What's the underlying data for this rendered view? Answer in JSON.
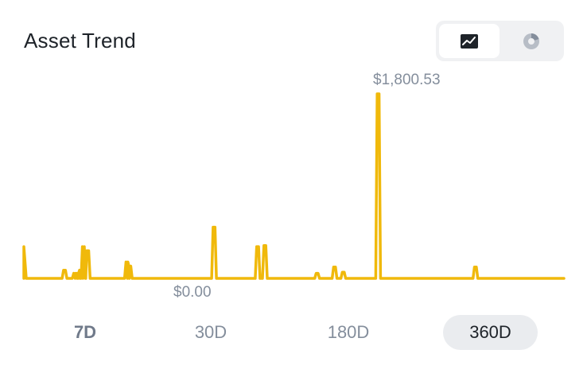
{
  "header": {
    "title": "Asset Trend"
  },
  "view_toggle": {
    "options": [
      {
        "icon": "line-chart-icon",
        "selected": true
      },
      {
        "icon": "pie-chart-icon",
        "selected": false
      }
    ]
  },
  "labels": {
    "max": "$1,800.53",
    "min": "$0.00"
  },
  "ranges": {
    "items": [
      "7D",
      "30D",
      "180D",
      "360D"
    ],
    "selected": "360D"
  },
  "colors": {
    "line": "#f0b90b",
    "title": "#1e2329",
    "muted": "#848e9c",
    "selected_bg": "#eaecef"
  },
  "chart_data": {
    "type": "line",
    "x_unit": "day index",
    "ylim": [
      0,
      1800.53
    ],
    "spikes": [
      {
        "day": 0,
        "value": 310
      },
      {
        "day": 28,
        "value": 80
      },
      {
        "day": 35,
        "value": 50
      },
      {
        "day": 37,
        "value": 50
      },
      {
        "day": 39,
        "value": 80
      },
      {
        "day": 41,
        "value": 310
      },
      {
        "day": 44,
        "value": 270
      },
      {
        "day": 71,
        "value": 160
      },
      {
        "day": 73,
        "value": 120
      },
      {
        "day": 131,
        "value": 500
      },
      {
        "day": 161,
        "value": 310
      },
      {
        "day": 166,
        "value": 320
      },
      {
        "day": 202,
        "value": 50
      },
      {
        "day": 214,
        "value": 110
      },
      {
        "day": 220,
        "value": 60
      },
      {
        "day": 244,
        "value": 1800.53
      },
      {
        "day": 311,
        "value": 110
      }
    ],
    "x_max": 372
  }
}
